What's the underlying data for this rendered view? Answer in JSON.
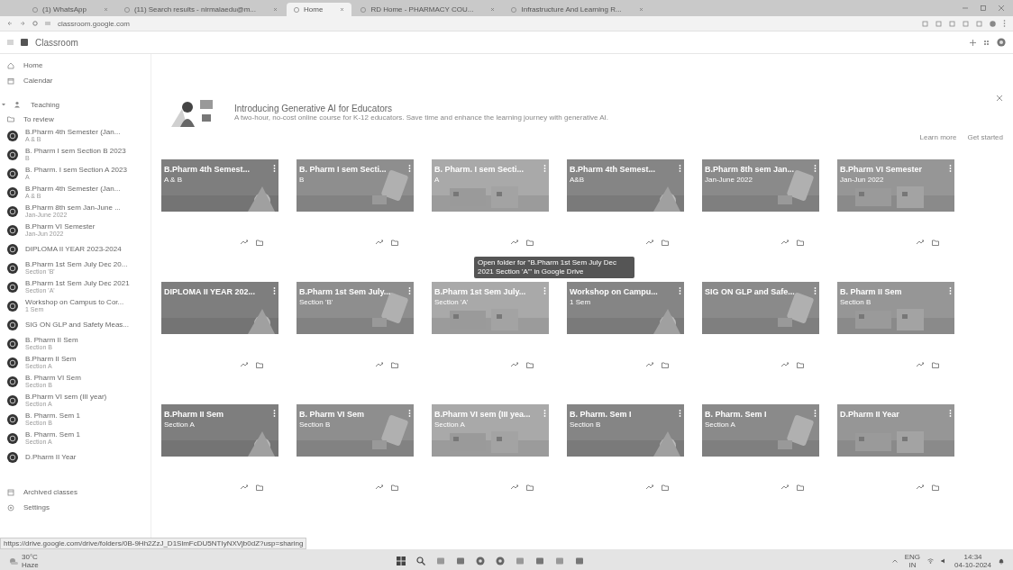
{
  "browser": {
    "tabs": [
      {
        "title": "(1) WhatsApp",
        "selected": false
      },
      {
        "title": "(11) Search results - nirmalaedu@m...",
        "selected": false
      },
      {
        "title": "Home",
        "selected": true
      },
      {
        "title": "RD Home - PHARMACY COU...",
        "selected": false
      },
      {
        "title": "Infrastructure And Learning R...",
        "selected": false
      }
    ],
    "address": "classroom.google.com"
  },
  "app": {
    "title": "Classroom"
  },
  "sidebar": {
    "items": [
      {
        "label": "Home",
        "kind": "home"
      },
      {
        "label": "Calendar",
        "kind": "calendar"
      }
    ],
    "teaching": {
      "label": "Teaching",
      "expanded": true,
      "to_review": "To review",
      "classes": [
        {
          "name": "B.Pharm 4th Semester (Jan...",
          "section": "A & B"
        },
        {
          "name": "B. Pharm I sem Section B 2023",
          "section": "B"
        },
        {
          "name": "B. Pharm. I sem Section A 2023",
          "section": "A"
        },
        {
          "name": "B.Pharm 4th Semester (Jan...",
          "section": "A & B"
        },
        {
          "name": "B.Pharm 8th sem Jan-June ...",
          "section": "Jan-June 2022"
        },
        {
          "name": "B.Pharm VI Semester",
          "section": "Jan-Jun 2022"
        },
        {
          "name": "DIPLOMA II YEAR 2023-2024"
        },
        {
          "name": "B.Pharm 1st Sem July Dec 20...",
          "section": "Section 'B'"
        },
        {
          "name": "B.Pharm 1st Sem July Dec 2021",
          "section": "Section 'A'"
        },
        {
          "name": "Workshop on Campus to Cor...",
          "section": "1 Sem"
        },
        {
          "name": "SIG ON GLP and Safety Meas..."
        },
        {
          "name": "B. Pharm II Sem",
          "section": "Section B"
        },
        {
          "name": "B.Pharm II Sem",
          "section": "Section A"
        },
        {
          "name": "B. Pharm VI Sem",
          "section": "Section B"
        },
        {
          "name": "B.Pharm VI sem (III year)",
          "section": "Section A"
        },
        {
          "name": "B. Pharm. Sem 1",
          "section": "Section B"
        },
        {
          "name": "B. Pharm. Sem 1",
          "section": "Section A"
        },
        {
          "name": "D.Pharm II Year"
        }
      ]
    },
    "footer": [
      {
        "label": "Archived classes",
        "kind": "archive"
      },
      {
        "label": "Settings",
        "kind": "settings"
      }
    ]
  },
  "banner": {
    "title": "Introducing Generative AI for Educators",
    "text": "A two-hour, no-cost online course for K-12 educators. Save time and enhance the learning journey with generative AI.",
    "buttons": [
      "Learn more",
      "Get started"
    ]
  },
  "classes": [
    {
      "name": "B.Pharm 4th Semest...",
      "section": "A & B"
    },
    {
      "name": "B. Pharm I sem Secti...",
      "section": "B"
    },
    {
      "name": "B. Pharm. I sem Secti...",
      "section": "A"
    },
    {
      "name": "B.Pharm 4th Semest...",
      "section": "A&B"
    },
    {
      "name": "B.Pharm 8th sem Jan...",
      "section": "Jan-June 2022"
    },
    {
      "name": "B.Pharm VI Semester",
      "section": "Jan-Jun 2022"
    },
    {
      "name": "DIPLOMA II YEAR 202..."
    },
    {
      "name": "B.Pharm 1st Sem July...",
      "section": "Section 'B'"
    },
    {
      "name": "B.Pharm 1st Sem July...",
      "section": "Section 'A'",
      "tooltip": "Open folder for \"B.Pharm 1st Sem July Dec 2021 Section 'A'\" in Google Drive"
    },
    {
      "name": "Workshop on Campu...",
      "section": "1 Sem"
    },
    {
      "name": "SIG ON GLP and Safe..."
    },
    {
      "name": "B. Pharm II Sem",
      "section": "Section B"
    },
    {
      "name": "B.Pharm II Sem",
      "section": "Section A"
    },
    {
      "name": "B. Pharm VI Sem",
      "section": "Section B"
    },
    {
      "name": "B.Pharm VI sem (III yea...",
      "section": "Section A"
    },
    {
      "name": "B. Pharm. Sem I",
      "section": "Section B"
    },
    {
      "name": "B. Pharm. Sem I",
      "section": "Section A"
    },
    {
      "name": "D.Pharm II Year"
    }
  ],
  "status_url": "https://drive.google.com/drive/folders/0B-9Hh2ZzJ_D1SlmFcDU5NTIyNXVjb0dZ?usp=sharing",
  "taskbar": {
    "weather": "30°C",
    "condition": "Haze",
    "language": "ENG",
    "region": "IN",
    "time": "14:34",
    "date": "04-10-2024"
  }
}
